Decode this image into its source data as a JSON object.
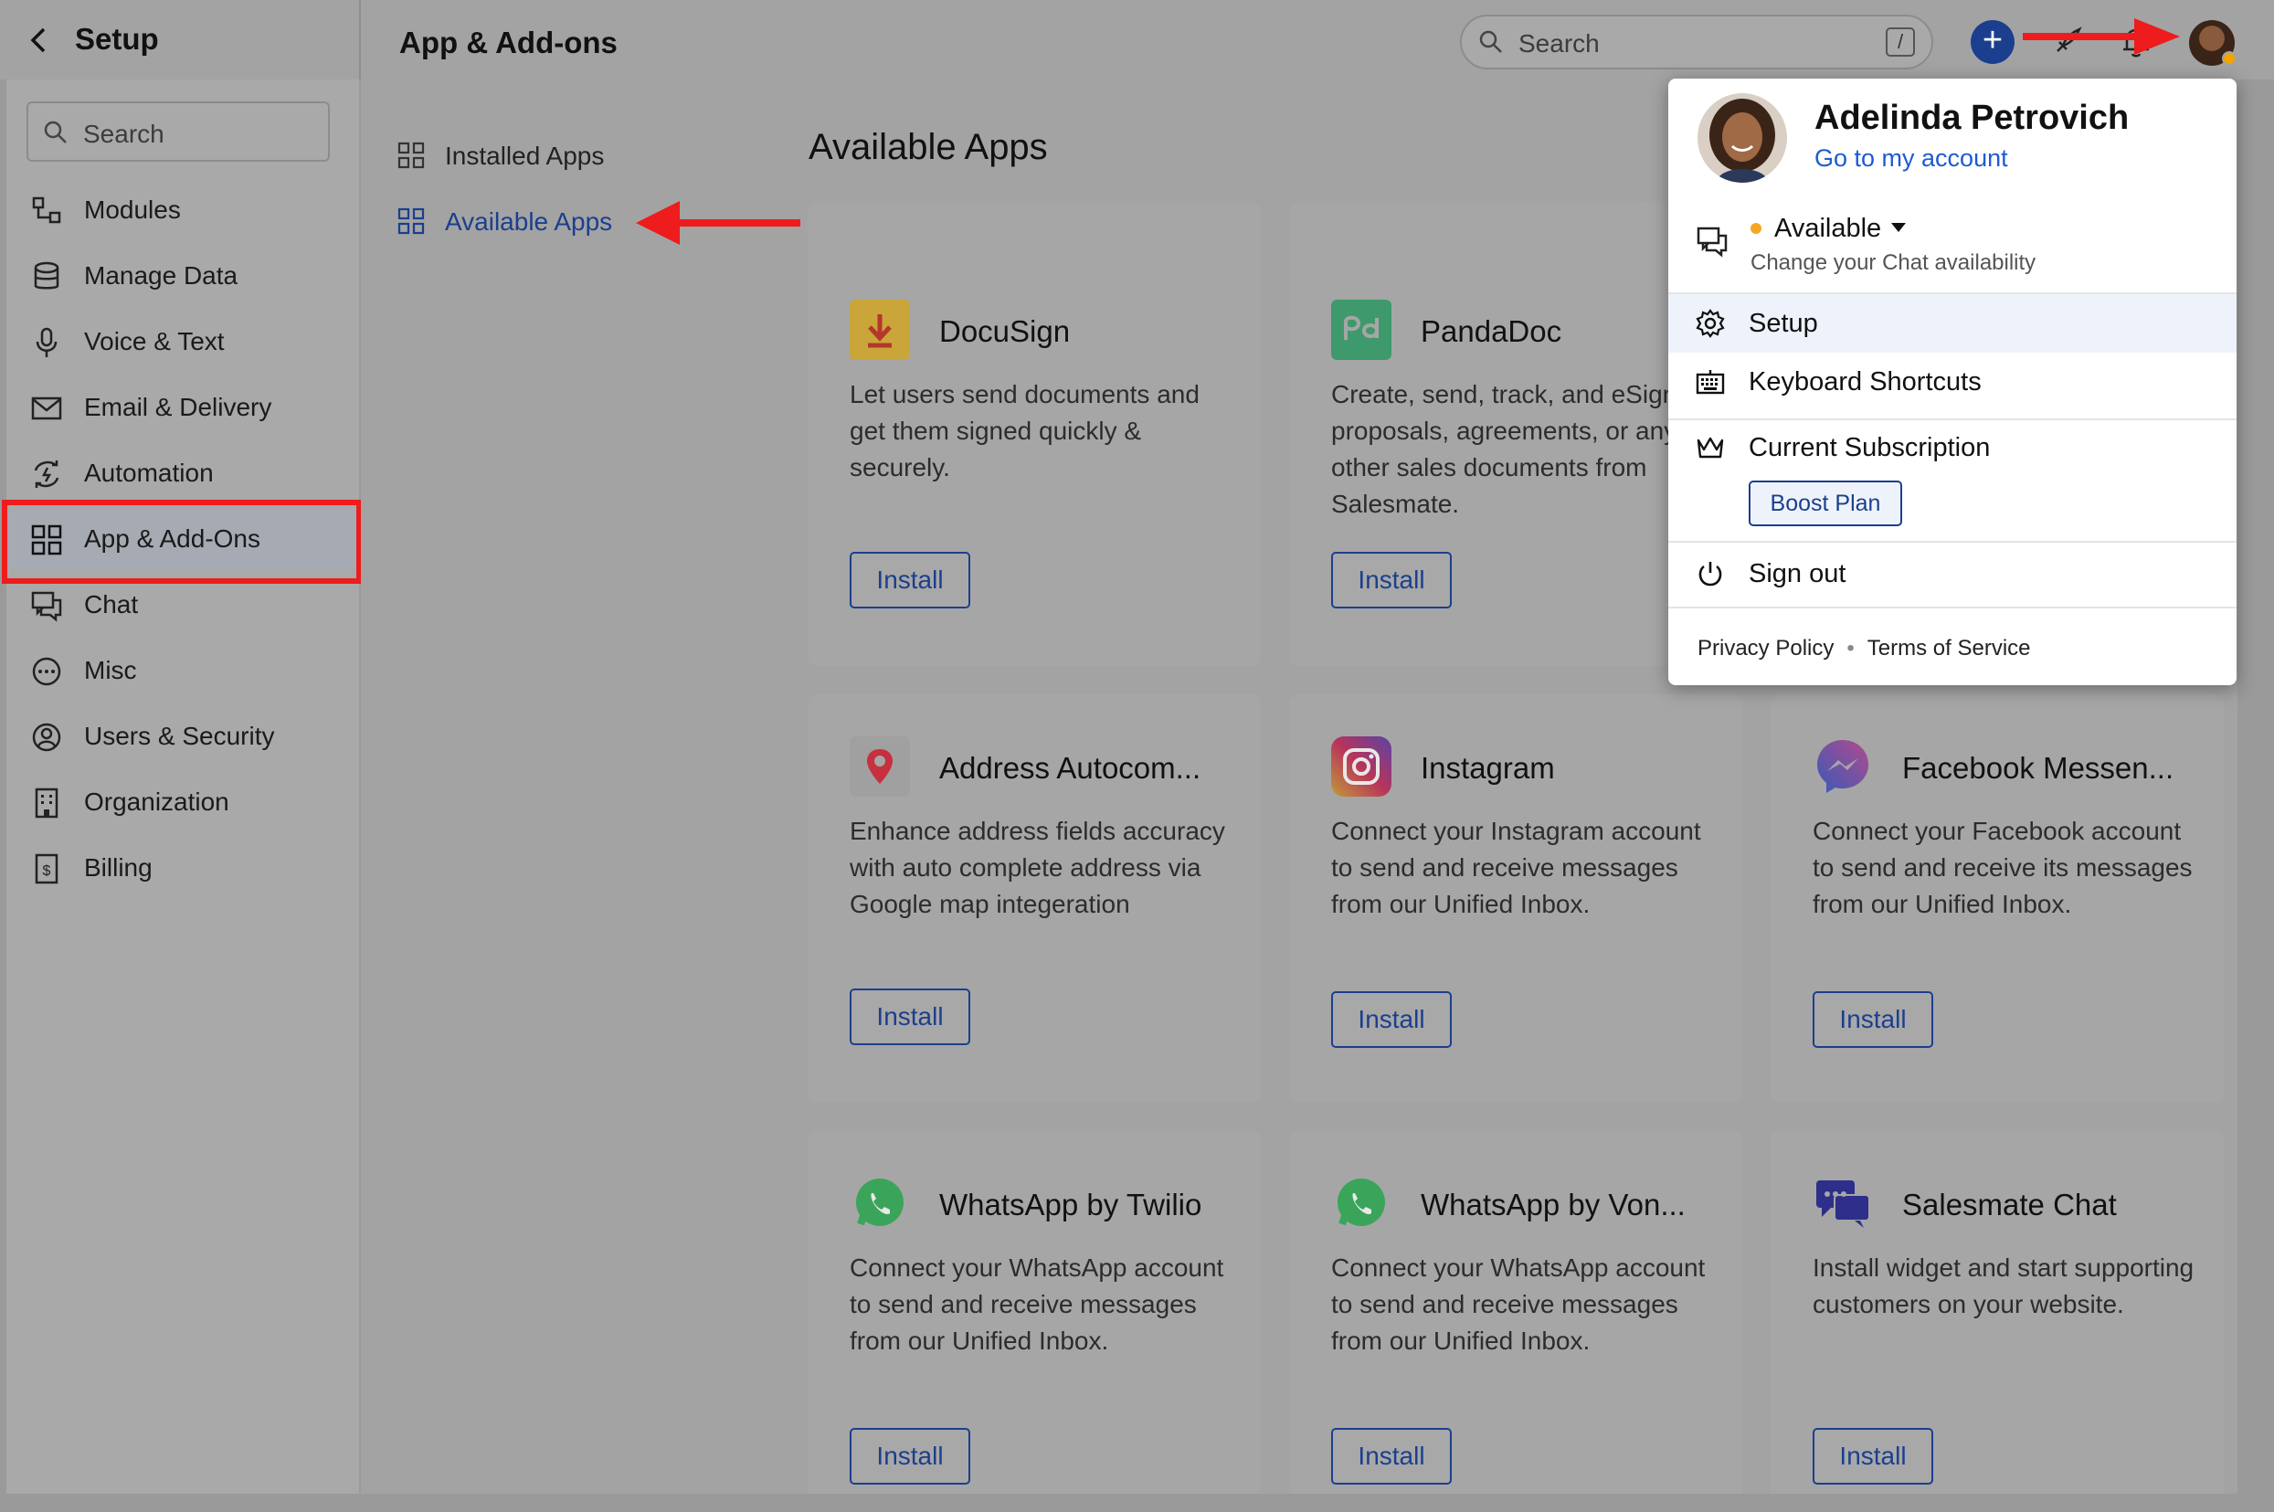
{
  "topbar": {
    "setup_title": "Setup",
    "page_title": "App & Add-ons",
    "search_placeholder": "Search",
    "search_shortcut": "/",
    "plus_label": "+"
  },
  "sidebar": {
    "search_placeholder": "Search",
    "items": [
      {
        "label": "Modules",
        "icon": "modules-icon"
      },
      {
        "label": "Manage Data",
        "icon": "database-icon"
      },
      {
        "label": "Voice & Text",
        "icon": "microphone-icon"
      },
      {
        "label": "Email & Delivery",
        "icon": "envelope-icon"
      },
      {
        "label": "Automation",
        "icon": "automation-icon"
      },
      {
        "label": "App & Add-Ons",
        "icon": "grid-icon",
        "active": true
      },
      {
        "label": "Chat",
        "icon": "chat-icon"
      },
      {
        "label": "Misc",
        "icon": "more-icon"
      },
      {
        "label": "Users & Security",
        "icon": "user-circle-icon"
      },
      {
        "label": "Organization",
        "icon": "building-icon"
      },
      {
        "label": "Billing",
        "icon": "billing-icon"
      }
    ]
  },
  "subnav": {
    "installed": "Installed Apps",
    "available": "Available Apps"
  },
  "main": {
    "title": "Available Apps",
    "apps": [
      {
        "name": "DocuSign",
        "desc": "Let users send documents and get them signed quickly & securely.",
        "install": "Install"
      },
      {
        "name": "PandaDoc",
        "desc": "Create, send, track, and eSign proposals, agreements, or any other sales documents from Salesmate.",
        "install": "Install"
      },
      {
        "name": "Address Autocom...",
        "desc": "Enhance address fields accuracy with auto complete address via Google map integeration",
        "install": "Install"
      },
      {
        "name": "Instagram",
        "desc": "Connect your Instagram account to send and receive messages from our Unified Inbox.",
        "install": "Install"
      },
      {
        "name": "Facebook Messen...",
        "desc": "Connect your Facebook account to send and receive its messages from our Unified Inbox.",
        "install": "Install"
      },
      {
        "name": "WhatsApp by Twilio",
        "desc": "Connect your WhatsApp account to send and receive messages from our Unified Inbox.",
        "install": "Install"
      },
      {
        "name": "WhatsApp by Von...",
        "desc": "Connect your WhatsApp account to send and receive messages from our Unified Inbox.",
        "install": "Install"
      },
      {
        "name": "Salesmate Chat",
        "desc": "Install widget and start supporting customers on your website.",
        "install": "Install"
      }
    ]
  },
  "menu": {
    "user_name": "Adelinda Petrovich",
    "account_link": "Go to my account",
    "status": "Available",
    "status_sub": "Change your Chat availability",
    "setup": "Setup",
    "shortcuts": "Keyboard Shortcuts",
    "subscription": "Current Subscription",
    "plan": "Boost Plan",
    "sign_out": "Sign out",
    "privacy": "Privacy Policy",
    "terms": "Terms of Service"
  },
  "colors": {
    "accent": "#1b3f8e",
    "link": "#1e5bd1",
    "highlight_red": "#ee1c1c",
    "status_dot": "#f5a623"
  }
}
